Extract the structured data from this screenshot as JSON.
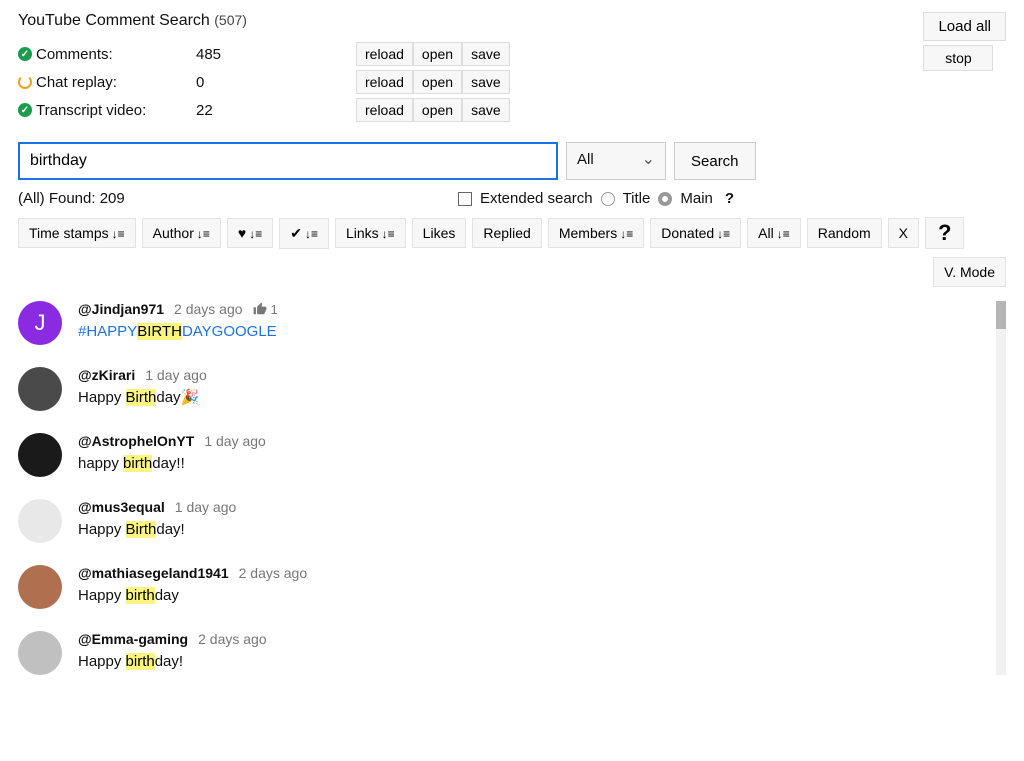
{
  "header": {
    "title": "YouTube Comment Search",
    "count": "(507)",
    "load_all": "Load all",
    "stop": "stop"
  },
  "stats": {
    "rows": [
      {
        "icon": "check",
        "label": "Comments:",
        "value": "485"
      },
      {
        "icon": "spin",
        "label": "Chat replay:",
        "value": "0"
      },
      {
        "icon": "check",
        "label": "Transcript video:",
        "value": "22"
      }
    ],
    "reload": "reload",
    "open": "open",
    "save": "save"
  },
  "search": {
    "value": "birthday",
    "filter_selected": "All",
    "button": "Search"
  },
  "found": {
    "label": "(All) Found: 209",
    "extended": "Extended search",
    "title": "Title",
    "main": "Main",
    "q": "?"
  },
  "filters": {
    "timestamps": "Time stamps",
    "author": "Author",
    "heart": "♥",
    "check": "✔",
    "links": "Links",
    "likes": "Likes",
    "replied": "Replied",
    "members": "Members",
    "donated": "Donated",
    "all": "All",
    "random": "Random",
    "x": "X",
    "q": "?",
    "vmode": "V. Mode"
  },
  "comments": [
    {
      "author": "@Jindjan971",
      "time": "2 days ago",
      "likes": "1",
      "pre": "#HAPPY",
      "hl": "BIRTH",
      "post": "DAYGOOGLE",
      "link": true,
      "avatar_bg": "#8a2be2",
      "avatar_letter": "J"
    },
    {
      "author": "@zKirari",
      "time": "1 day ago",
      "pre": "Happy ",
      "hl": "Birth",
      "post": "day🎉",
      "avatar_bg": "#4a4a4a"
    },
    {
      "author": "@AstrophelOnYT",
      "time": "1 day ago",
      "pre": "happy ",
      "hl": "birth",
      "post": "day!!",
      "avatar_bg": "#1a1a1a"
    },
    {
      "author": "@mus3equal",
      "time": "1 day ago",
      "pre": "Happy ",
      "hl": "Birth",
      "post": "day!",
      "avatar_bg": "#e8e8e8"
    },
    {
      "author": "@mathiasegeland1941",
      "time": "2 days ago",
      "pre": "Happy ",
      "hl": "birth",
      "post": "day",
      "avatar_bg": "#b07050"
    },
    {
      "author": "@Emma-gaming",
      "time": "2 days ago",
      "pre": "Happy ",
      "hl": "birth",
      "post": "day!",
      "avatar_bg": "#c0c0c0"
    }
  ]
}
